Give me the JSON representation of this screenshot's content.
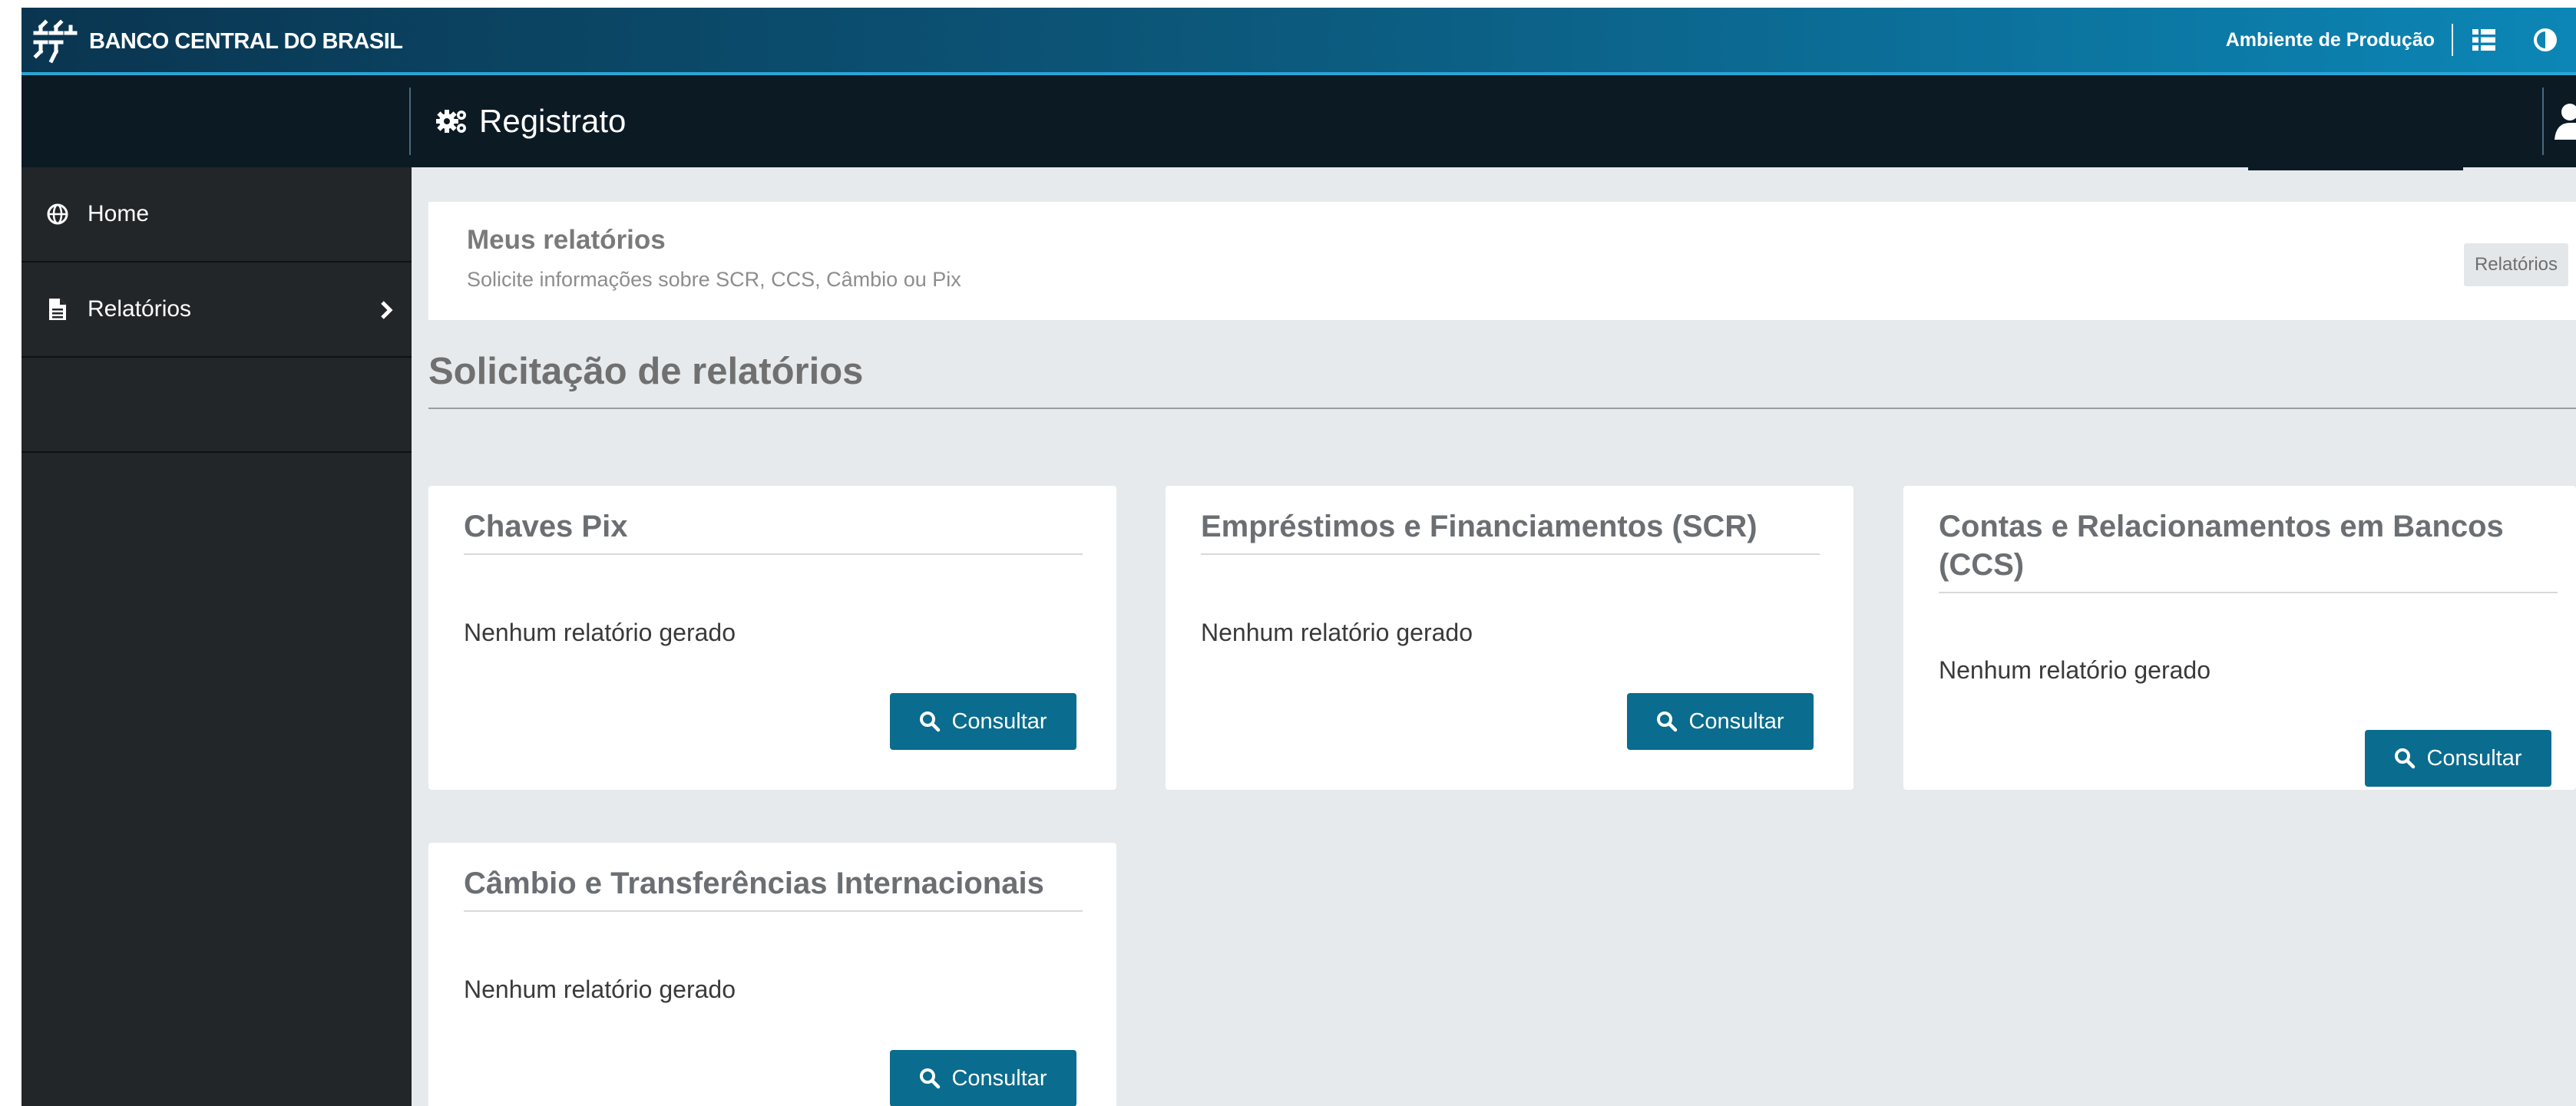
{
  "brand": {
    "name": "BANCO CENTRAL DO BRASIL",
    "logo_icon": "bcb-logo-icon"
  },
  "topbar": {
    "environment_label": "Ambiente de Produção",
    "apps_icon": "grid-menu-icon",
    "contrast_icon": "contrast-icon"
  },
  "subbar": {
    "app_title": "Registrato",
    "app_icon": "cogs-icon",
    "user_icon": "user-icon"
  },
  "sidebar": {
    "items": [
      {
        "label": "Home",
        "icon": "globe-icon"
      },
      {
        "label": "Relatórios",
        "icon": "file-icon",
        "chevron": "chevron-right-icon"
      }
    ]
  },
  "page_header": {
    "title": "Meus relatórios",
    "subtitle": "Solicite informações sobre SCR, CCS, Câmbio ou Pix",
    "breadcrumb": "Relatórios"
  },
  "section": {
    "title": "Solicitação de relatórios"
  },
  "cards": [
    {
      "title": "Chaves Pix",
      "status": "Nenhum relatório gerado",
      "button_label": "Consultar"
    },
    {
      "title": "Empréstimos e Financiamentos (SCR)",
      "status": "Nenhum relatório gerado",
      "button_label": "Consultar"
    },
    {
      "title": "Contas e Relacionamentos em Bancos (CCS)",
      "status": "Nenhum relatório gerado",
      "button_label": "Consultar"
    },
    {
      "title": "Câmbio e Transferências Internacionais",
      "status": "Nenhum relatório gerado",
      "button_label": "Consultar"
    }
  ],
  "colors": {
    "topbar_start": "#0a3550",
    "topbar_end": "#0c86b6",
    "subbar_bg": "#0c1a24",
    "sidebar_bg": "#232629",
    "content_bg": "#e6eaed",
    "button_bg": "#0a6c8e"
  }
}
